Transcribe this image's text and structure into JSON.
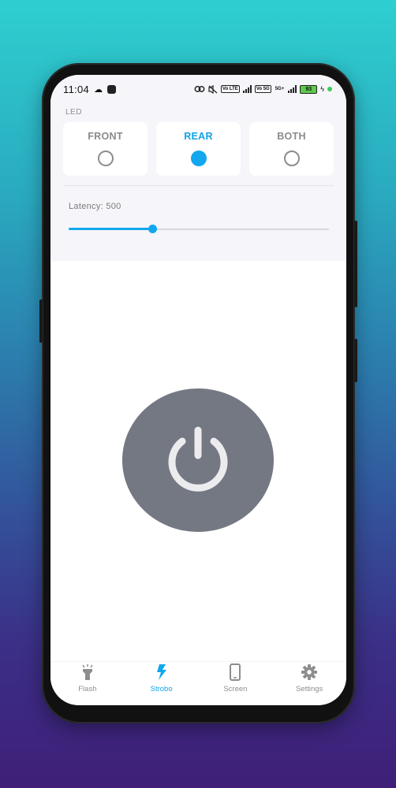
{
  "status_bar": {
    "time": "11:04",
    "network_tags": [
      "Vo LTE",
      "Vo 5G",
      "5G+"
    ],
    "battery": "93"
  },
  "led": {
    "section_label": "LED",
    "options": [
      {
        "label": "FRONT",
        "selected": false
      },
      {
        "label": "REAR",
        "selected": true
      },
      {
        "label": "BOTH",
        "selected": false
      }
    ]
  },
  "latency": {
    "label": "Latency: 500",
    "value": 500,
    "fraction": 0.32
  },
  "power_button": {
    "icon": "power-icon",
    "color": "#747883"
  },
  "nav": {
    "items": [
      {
        "label": "Flash",
        "icon": "flashlight-icon",
        "active": false
      },
      {
        "label": "Strobo",
        "icon": "bolt-icon",
        "active": true
      },
      {
        "label": "Screen",
        "icon": "phone-icon",
        "active": false
      },
      {
        "label": "Settings",
        "icon": "gear-icon",
        "active": false
      }
    ]
  },
  "colors": {
    "accent": "#12a7ee",
    "inactive": "#8e8e8e"
  }
}
